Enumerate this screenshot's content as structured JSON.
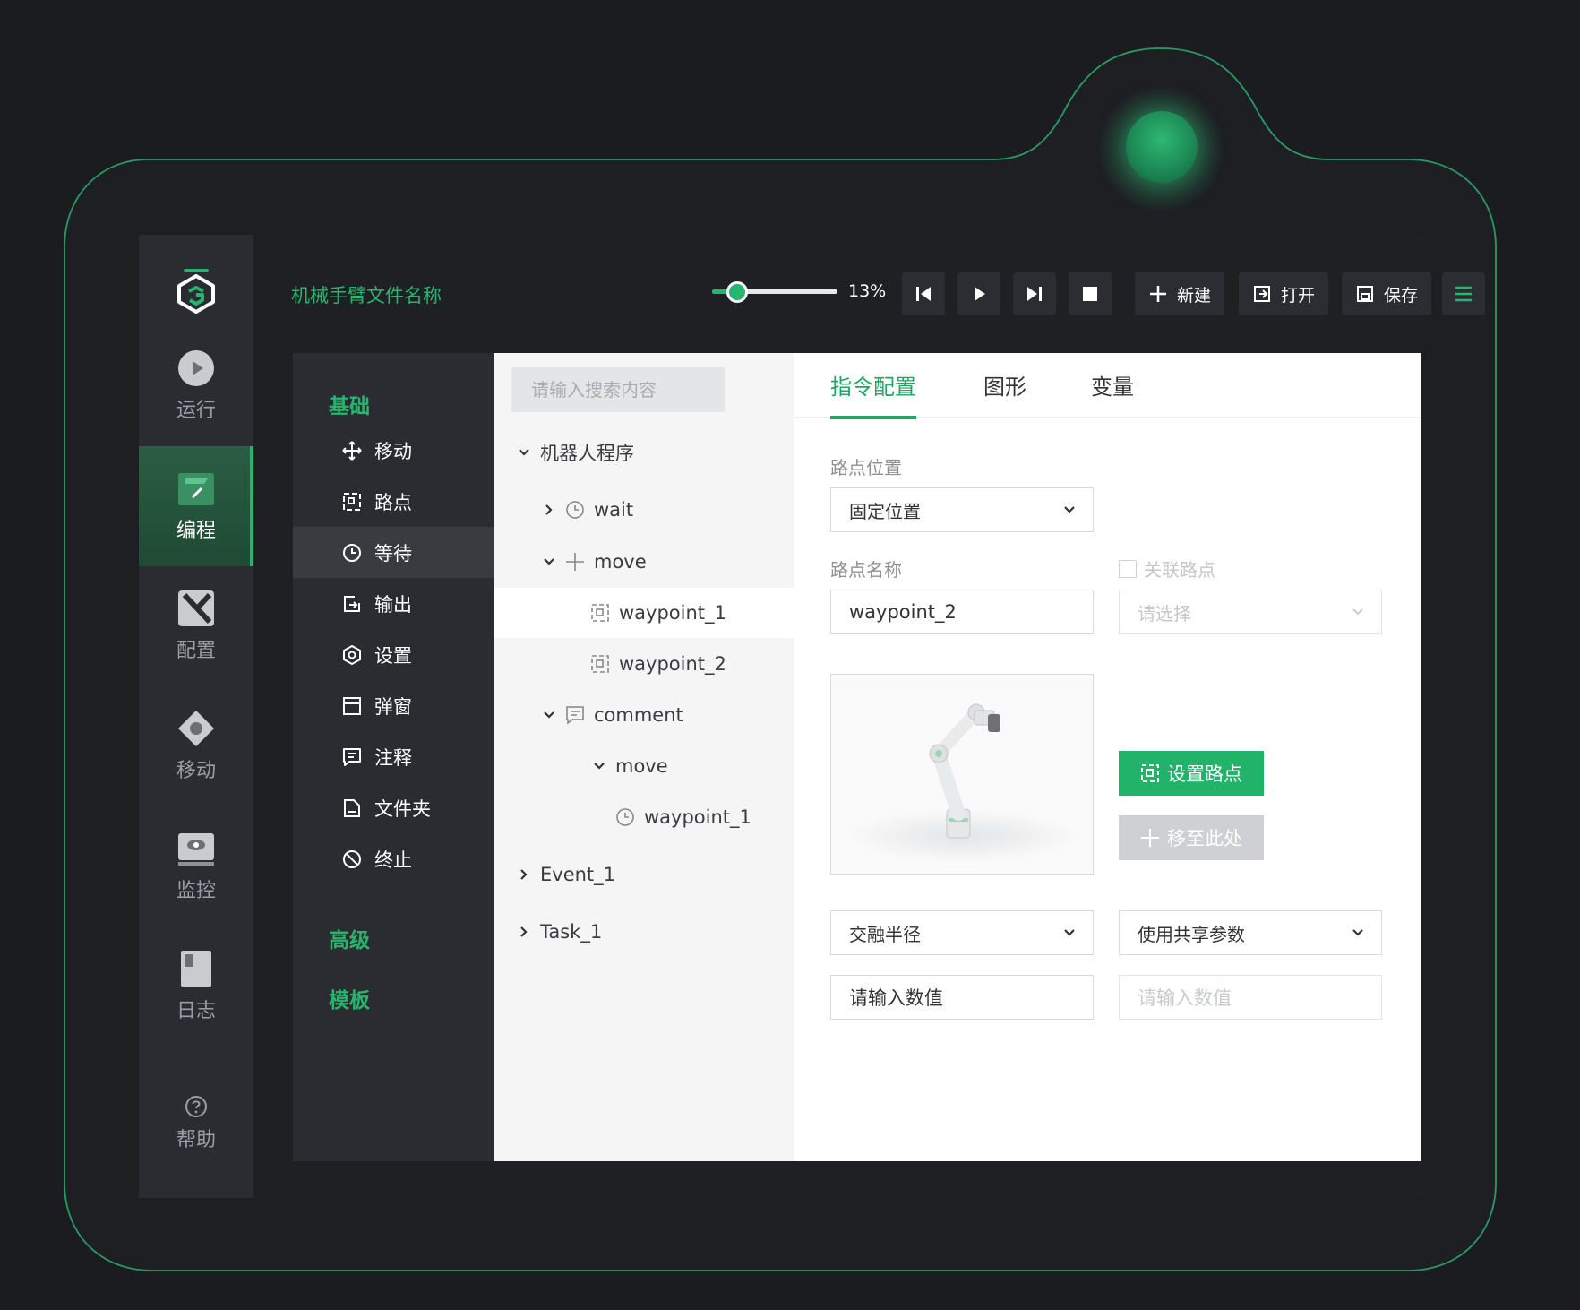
{
  "colors": {
    "accent": "#27b46f",
    "background": "#1b1c20",
    "panel": "#2a2c31"
  },
  "topbar": {
    "file_name": "机械手臂文件名称",
    "speed": "13%",
    "speed_fraction": 0.13,
    "buttons": {
      "new": "新建",
      "open": "打开",
      "save": "保存"
    }
  },
  "sidebar": {
    "items": [
      {
        "label": "运行",
        "icon": "play-icon"
      },
      {
        "label": "编程",
        "icon": "edit-icon"
      },
      {
        "label": "配置",
        "icon": "config-icon"
      },
      {
        "label": "移动",
        "icon": "move-icon"
      },
      {
        "label": "监控",
        "icon": "monitor-icon"
      },
      {
        "label": "日志",
        "icon": "log-icon"
      }
    ],
    "help": "帮助"
  },
  "palette": {
    "sections": {
      "basic": "基础",
      "advanced": "高级",
      "template": "模板"
    },
    "items": [
      {
        "label": "移动",
        "icon": "move-icon"
      },
      {
        "label": "路点",
        "icon": "waypoint-icon"
      },
      {
        "label": "等待",
        "icon": "clock-icon"
      },
      {
        "label": "输出",
        "icon": "output-icon"
      },
      {
        "label": "设置",
        "icon": "settings-icon"
      },
      {
        "label": "弹窗",
        "icon": "popup-icon"
      },
      {
        "label": "注释",
        "icon": "comment-icon"
      },
      {
        "label": "文件夹",
        "icon": "folder-icon"
      },
      {
        "label": "终止",
        "icon": "stop-icon"
      }
    ]
  },
  "tree": {
    "search_placeholder": "请输入搜索内容",
    "nodes": [
      {
        "label": "机器人程序"
      },
      {
        "label": "wait"
      },
      {
        "label": "move"
      },
      {
        "label": "waypoint_1"
      },
      {
        "label": "waypoint_2"
      },
      {
        "label": "comment"
      },
      {
        "label": "move"
      },
      {
        "label": "waypoint_1"
      },
      {
        "label": "Event_1"
      },
      {
        "label": "Task_1"
      }
    ]
  },
  "panel": {
    "tabs": [
      "指令配置",
      "图形",
      "变量"
    ],
    "waypoint_position_label": "路点位置",
    "waypoint_position_value": "固定位置",
    "waypoint_name_label": "路点名称",
    "waypoint_name_value": "waypoint_2",
    "link_waypoint_label": "关联路点",
    "link_waypoint_placeholder": "请选择",
    "set_waypoint_button": "设置路点",
    "move_here_button": "移至此处",
    "blend_radius_select": "交融半径",
    "shared_params_select": "使用共享参数",
    "value_input_placeholder": "请输入数值",
    "value_input_placeholder_disabled": "请输入数值"
  }
}
